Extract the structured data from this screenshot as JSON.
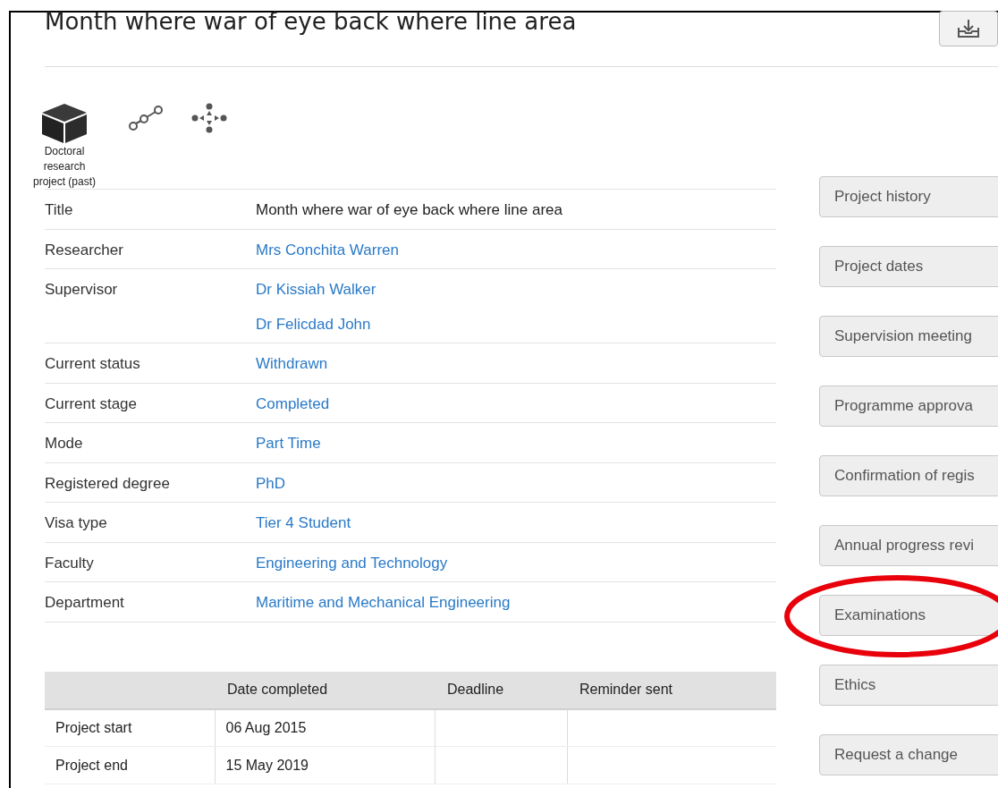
{
  "page_title": "Month where war of eye back where line area",
  "project_type": {
    "label": "Doctoral research project (past)"
  },
  "details": [
    {
      "label": "Title",
      "values": [
        "Month where war of eye back where line area"
      ],
      "link": false
    },
    {
      "label": "Researcher",
      "values": [
        "Mrs Conchita Warren"
      ],
      "link": true
    },
    {
      "label": "Supervisor",
      "values": [
        "Dr Kissiah Walker",
        "Dr Felicdad John"
      ],
      "link": true
    },
    {
      "label": "Current status",
      "values": [
        "Withdrawn"
      ],
      "link": true
    },
    {
      "label": "Current stage",
      "values": [
        "Completed"
      ],
      "link": true
    },
    {
      "label": "Mode",
      "values": [
        "Part Time"
      ],
      "link": true
    },
    {
      "label": "Registered degree",
      "values": [
        "PhD"
      ],
      "link": true
    },
    {
      "label": "Visa type",
      "values": [
        "Tier 4 Student"
      ],
      "link": true
    },
    {
      "label": "Faculty",
      "values": [
        "Engineering and Technology"
      ],
      "link": true
    },
    {
      "label": "Department",
      "values": [
        "Maritime and Mechanical Engineering"
      ],
      "link": true
    }
  ],
  "dates_table": {
    "columns": [
      "",
      "Date completed",
      "Deadline",
      "Reminder sent"
    ],
    "rows": [
      [
        "Project start",
        "06 Aug 2015",
        "",
        ""
      ],
      [
        "Project end",
        "15 May 2019",
        "",
        ""
      ]
    ]
  },
  "side_buttons": [
    {
      "label": "Project history",
      "circled": false
    },
    {
      "label": "Project dates",
      "circled": false
    },
    {
      "label": "Supervision meeting",
      "circled": false
    },
    {
      "label": "Programme approva",
      "circled": false
    },
    {
      "label": "Confirmation of regis",
      "circled": false
    },
    {
      "label": "Annual progress revi",
      "circled": false
    },
    {
      "label": "Examinations",
      "circled": true
    },
    {
      "label": "Ethics",
      "circled": false
    },
    {
      "label": "Request a change",
      "circled": false
    }
  ]
}
